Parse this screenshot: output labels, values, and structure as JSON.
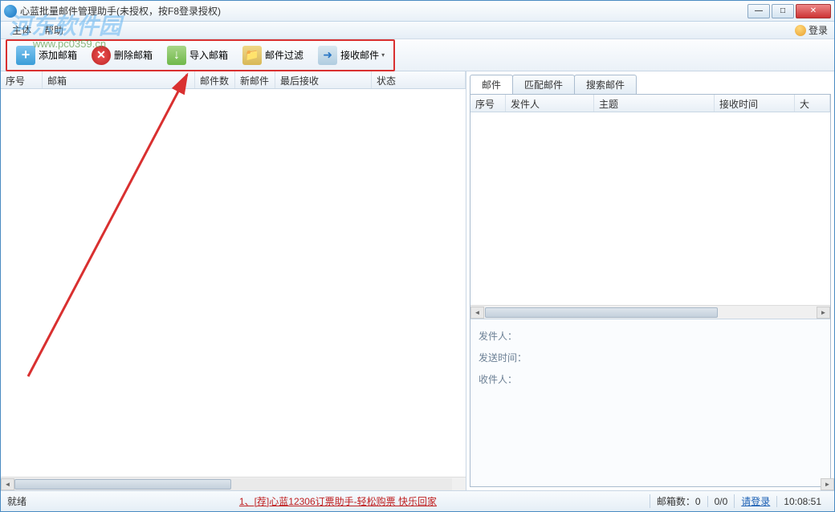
{
  "window": {
    "title": "心蓝批量邮件管理助手(未授权，按F8登录授权)"
  },
  "menu": {
    "file": "主体",
    "help": "帮助",
    "login": "登录"
  },
  "watermark": {
    "main": "河东软件园",
    "sub": "www.pc0359.cn"
  },
  "toolbar": {
    "add": "添加邮箱",
    "delete": "删除邮箱",
    "import": "导入邮箱",
    "filter": "邮件过滤",
    "receive": "接收邮件"
  },
  "leftGrid": {
    "columns": [
      "序号",
      "邮箱",
      "邮件数",
      "新邮件",
      "最后接收",
      "状态"
    ]
  },
  "rightTabs": {
    "mail": "邮件",
    "match": "匹配邮件",
    "search": "搜索邮件"
  },
  "rightGrid": {
    "columns": [
      "序号",
      "发件人",
      "主题",
      "接收时间",
      "大"
    ]
  },
  "detail": {
    "sender": "发件人：",
    "sendTime": "发送时间：",
    "recipient": "收件人："
  },
  "statusbar": {
    "ready": "就绪",
    "promo": "1、[荐]心蓝12306订票助手-轻松购票 快乐回家",
    "mailboxCount": "邮箱数：0",
    "ratio": "0/0",
    "loginPrompt": "请登录",
    "time": "10:08:51"
  }
}
